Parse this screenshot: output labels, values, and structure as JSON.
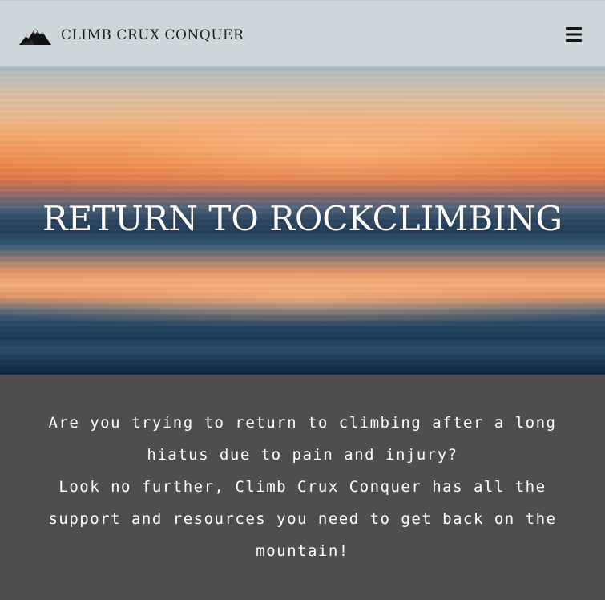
{
  "header": {
    "brand_name": "CLIMB CRUX CONQUER",
    "logo_icon": "mountain-icon",
    "menu_icon": "hamburger-menu-icon",
    "background_color": "#cdd7db"
  },
  "hero": {
    "title": "RETURN TO ROCKCLIMBING",
    "image_description_icon": "sunset-over-water-image"
  },
  "intro": {
    "line_1": "Are you trying to return to climbing after a long hiatus due to pain and injury?",
    "line_2": "Look no further, Climb Crux Conquer has all the support and resources you need to get back on the mountain!",
    "background_color": "#4e4e4e",
    "text_color": "#ffffff"
  }
}
